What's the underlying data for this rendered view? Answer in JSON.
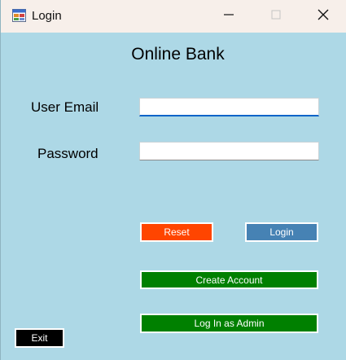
{
  "window": {
    "title": "Login",
    "icon": "app-form-icon",
    "controls": [
      "minimize-icon",
      "maximize-icon",
      "close-icon"
    ]
  },
  "form": {
    "heading": "Online Bank",
    "email_label": "User Email",
    "email_value": "",
    "password_label": "Password",
    "password_value": ""
  },
  "buttons": {
    "reset": "Reset",
    "login": "Login",
    "create_account": "Create Account",
    "admin_login": "Log In as Admin",
    "exit": "Exit"
  },
  "colors": {
    "background": "#add8e6",
    "reset": "#ff4500",
    "login": "#4682b4",
    "create_account": "#008000",
    "admin_login": "#008000",
    "exit": "#000000",
    "input_focus": "#0a64c8"
  }
}
